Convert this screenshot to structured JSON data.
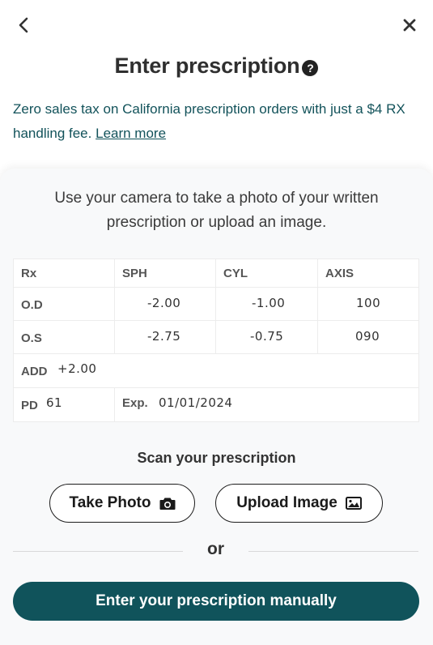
{
  "header": {
    "back_icon": "chevron-left-icon",
    "close_icon": "close-icon",
    "title": "Enter prescription",
    "help_icon_glyph": "?"
  },
  "notice": {
    "text": "Zero sales tax on California prescription orders with just a $4 RX handling fee.",
    "link_label": "Learn more"
  },
  "card": {
    "intro": "Use your camera to take a photo of your written prescription or upload an image.",
    "sample_rx": {
      "headers": [
        "Rx",
        "SPH",
        "CYL",
        "AXIS"
      ],
      "rows": [
        {
          "label": "O.D",
          "sph": "-2.00",
          "cyl": "-1.00",
          "axis": "100"
        },
        {
          "label": "O.S",
          "sph": "-2.75",
          "cyl": "-0.75",
          "axis": "090"
        }
      ],
      "add_label": "ADD",
      "add_value": "+2.00",
      "pd_label": "PD",
      "pd_value": "61",
      "exp_label": "Exp.",
      "exp_value": "01/01/2024"
    },
    "scan_label": "Scan your prescription",
    "take_photo_label": "Take Photo",
    "upload_image_label": "Upload Image",
    "or_label": "or",
    "manual_label": "Enter your prescription manually"
  },
  "colors": {
    "accent": "#10535b",
    "notice_text": "#12525a",
    "card_bg": "#f8f9fa"
  }
}
